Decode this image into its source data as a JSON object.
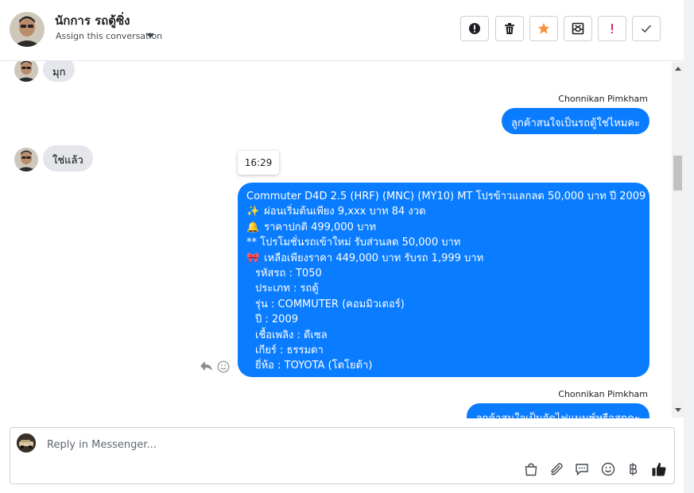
{
  "header": {
    "contact_name": "นักการ รถตู้ซิ่ง",
    "assign_label": "Assign this conversation",
    "actions": [
      "info-icon",
      "trash-icon",
      "star-icon",
      "mark-spam-icon",
      "exclamation-icon",
      "check-icon"
    ],
    "star_color": "#f7923b",
    "exclamation_color": "#e0245e"
  },
  "messages": {
    "incoming_1": "มุก",
    "sender_1": "Chonnikan Pimkham",
    "outgoing_1": "ลูกค้าสนใจเป็นรถตู้ใช่ไหมคะ",
    "incoming_2": "ใช่แล้ว",
    "time_chip": "16:29",
    "long_message": {
      "l1": "Commuter D4D 2.5 (HRF) (MNC) (MY10) MT โปรข้าวแลกลด 50,000 บาท ปี 2009",
      "l2_emoji": "✨",
      "l2": "ผ่อนเริ่มต้นเพียง 9,xxx บาท  84 งวด",
      "l3_emoji": "🔔",
      "l3": "ราคาปกติ 499,000 บาท",
      "l4": "** โปรโมชั่นรถเข้าใหม่ รับส่วนลด 50,000 บาท",
      "l5_emoji": "🎀",
      "l5": "เหลือเพียงราคา 449,000 บาท รับรถ 1,999 บาท",
      "l6": "รหัสรถ : T050",
      "l7": "ประเภท : รถตู้",
      "l8": "รุ่น : COMMUTER (คอมมิวเตอร์)",
      "l9": "ปี : 2009",
      "l10": "เชื้อเพลิง : ดีเซล",
      "l11": "เกียร์ : ธรรมดา",
      "l12": "ยี่ห้อ : TOYOTA (โตโยต้า)"
    },
    "sender_2": "Chonnikan Pimkham",
    "outgoing_2": "ลูกค้าสนใจเป็นจัดไฟแนนซ์หรือสดคะ"
  },
  "composer": {
    "placeholder": "Reply in Messenger...",
    "icons": [
      "bag-icon",
      "attach-icon",
      "saved-reply-icon",
      "emoji-icon",
      "baht-icon",
      "thumbs-up-icon"
    ]
  },
  "colors": {
    "outgoing_bubble": "#0a7cff",
    "incoming_bubble": "#e4e6eb"
  }
}
